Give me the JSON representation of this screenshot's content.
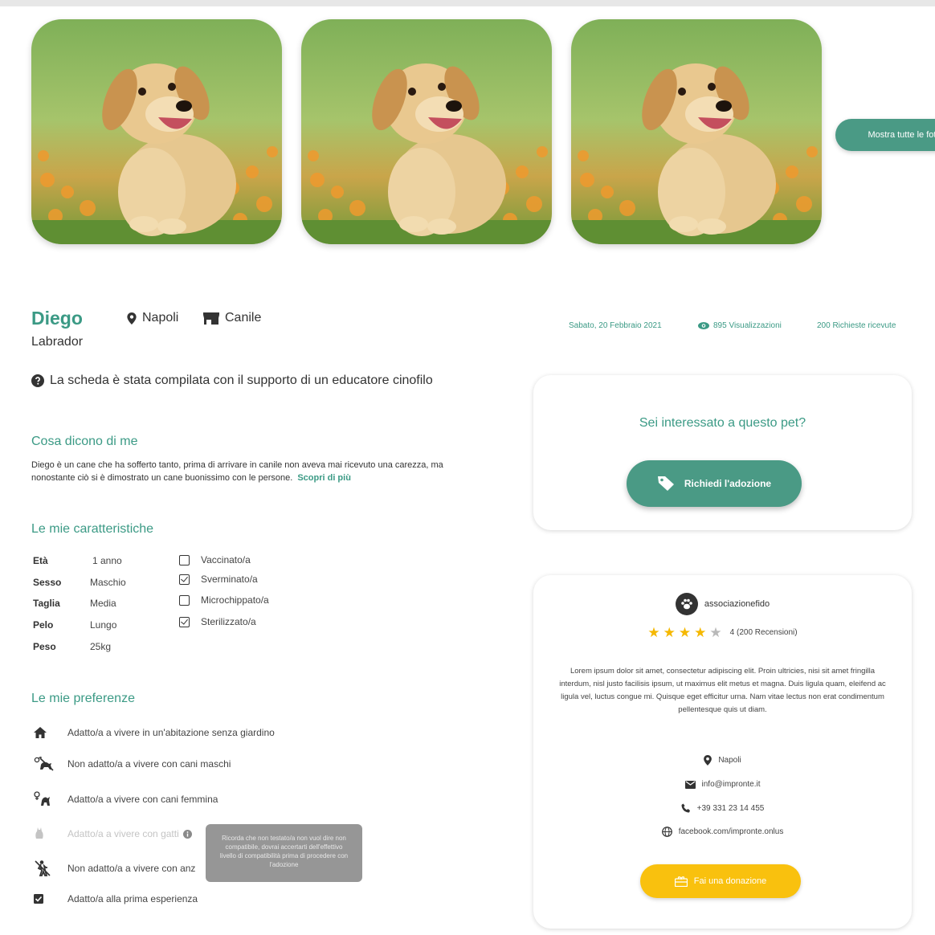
{
  "gallery": {
    "show_all_label": "Mostra tutte le foto"
  },
  "pet": {
    "name": "Diego",
    "breed": "Labrador",
    "location": "Napoli",
    "place": "Canile",
    "support_note": "La scheda è stata compilata con il supporto di un educatore cinofilo"
  },
  "stats": {
    "date": "Sabato, 20 Febbraio 2021",
    "views": "895 Visualizzazioni",
    "requests": "200 Richieste ricevute"
  },
  "about": {
    "title": "Cosa dicono di me",
    "text": "Diego è un cane che ha sofferto tanto, prima di arrivare in canile non aveva mai ricevuto una carezza, ma nonostante ciò si è dimostrato un cane buonissimo con le persone.",
    "more_label": "Scopri di più"
  },
  "characteristics": {
    "title": "Le mie caratteristiche",
    "rows": [
      {
        "label": "Età",
        "value": "1 anno"
      },
      {
        "label": "Sesso",
        "value": "Maschio"
      },
      {
        "label": "Taglia",
        "value": "Media"
      },
      {
        "label": "Pelo",
        "value": "Lungo"
      },
      {
        "label": "Peso",
        "value": "25kg"
      }
    ],
    "checks": [
      {
        "label": "Vaccinato/a",
        "checked": false
      },
      {
        "label": "Sverminato/a",
        "checked": true
      },
      {
        "label": "Microchippato/a",
        "checked": false
      },
      {
        "label": "Sterilizzato/a",
        "checked": true
      }
    ]
  },
  "preferences": {
    "title": "Le mie preferenze",
    "items": [
      {
        "label": "Adatto/a a vivere in un'abitazione senza giardino",
        "icon": "house-icon"
      },
      {
        "label": "Non adatto/a a vivere con cani maschi",
        "icon": "male-dog-crossed-icon"
      },
      {
        "label": "Adatto/a a vivere con cani femmina",
        "icon": "female-dog-icon"
      },
      {
        "label": "Adatto/a a vivere con gatti",
        "icon": "cat-icon"
      },
      {
        "label": "Non adatto/a a vivere con anz",
        "icon": "elderly-crossed-icon"
      },
      {
        "label": "Adatto/a alla prima esperienza",
        "icon": "checkbox-icon"
      }
    ],
    "tooltip": "Ricorda che non testato/a non vuol dire non compatibile, dovrai accertarti dell'effettivo livello di compatibilità prima di procedere con l'adozione"
  },
  "adoption_card": {
    "title": "Sei interessato a questo pet?",
    "button_label": "Richiedi l'adozione"
  },
  "association": {
    "name": "associazionefido",
    "rating": 4,
    "rating_text": "4 (200 Recensioni)",
    "description": "Lorem ipsum dolor sit amet, consectetur adipiscing elit. Proin ultricies, nisi sit amet fringilla interdum, nisl justo facilisis ipsum, ut maximus elit metus et magna. Duis ligula quam, eleifend ac ligula vel, luctus congue mi. Quisque eget efficitur urna. Nam vitae lectus non erat condimentum pellentesque quis ut diam.",
    "city": "Napoli",
    "email": "info@impronte.it",
    "phone": "+39 331 23 14 455",
    "website": "facebook.com/impronte.onlus",
    "donate_label": "Fai una donazione"
  },
  "colors": {
    "accent": "#3b9a85",
    "button": "#4a9a85",
    "donate": "#f9c10e",
    "star": "#f5b800"
  }
}
